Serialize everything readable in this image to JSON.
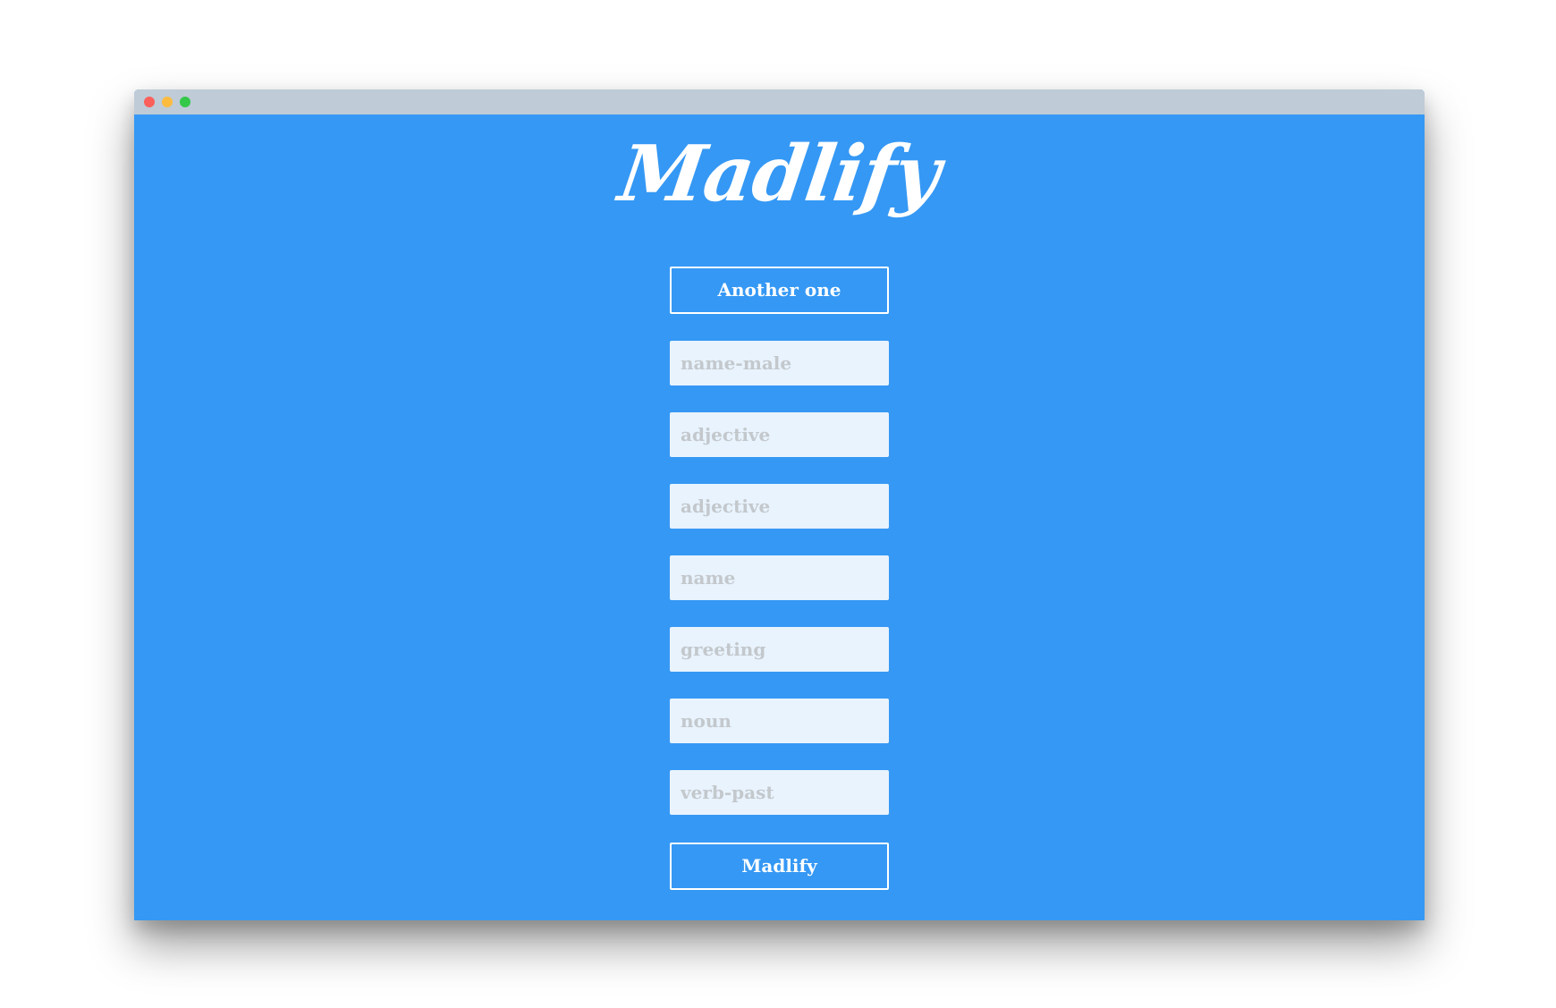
{
  "app": {
    "logo_text": "Madlify"
  },
  "window_controls": {
    "close_color": "#fc605b",
    "minimize_color": "#fdbc40",
    "maximize_color": "#34c84a"
  },
  "theme": {
    "background": "#3598f4",
    "titlebar": "#bfcbd7",
    "field_background": "#e8f3fd"
  },
  "form": {
    "another_button_label": "Another one",
    "fields": [
      {
        "placeholder": "name-male",
        "value": ""
      },
      {
        "placeholder": "adjective",
        "value": ""
      },
      {
        "placeholder": "adjective",
        "value": ""
      },
      {
        "placeholder": "name",
        "value": ""
      },
      {
        "placeholder": "greeting",
        "value": ""
      },
      {
        "placeholder": "noun",
        "value": ""
      },
      {
        "placeholder": "verb-past",
        "value": ""
      }
    ],
    "submit_button_label": "Madlify"
  }
}
